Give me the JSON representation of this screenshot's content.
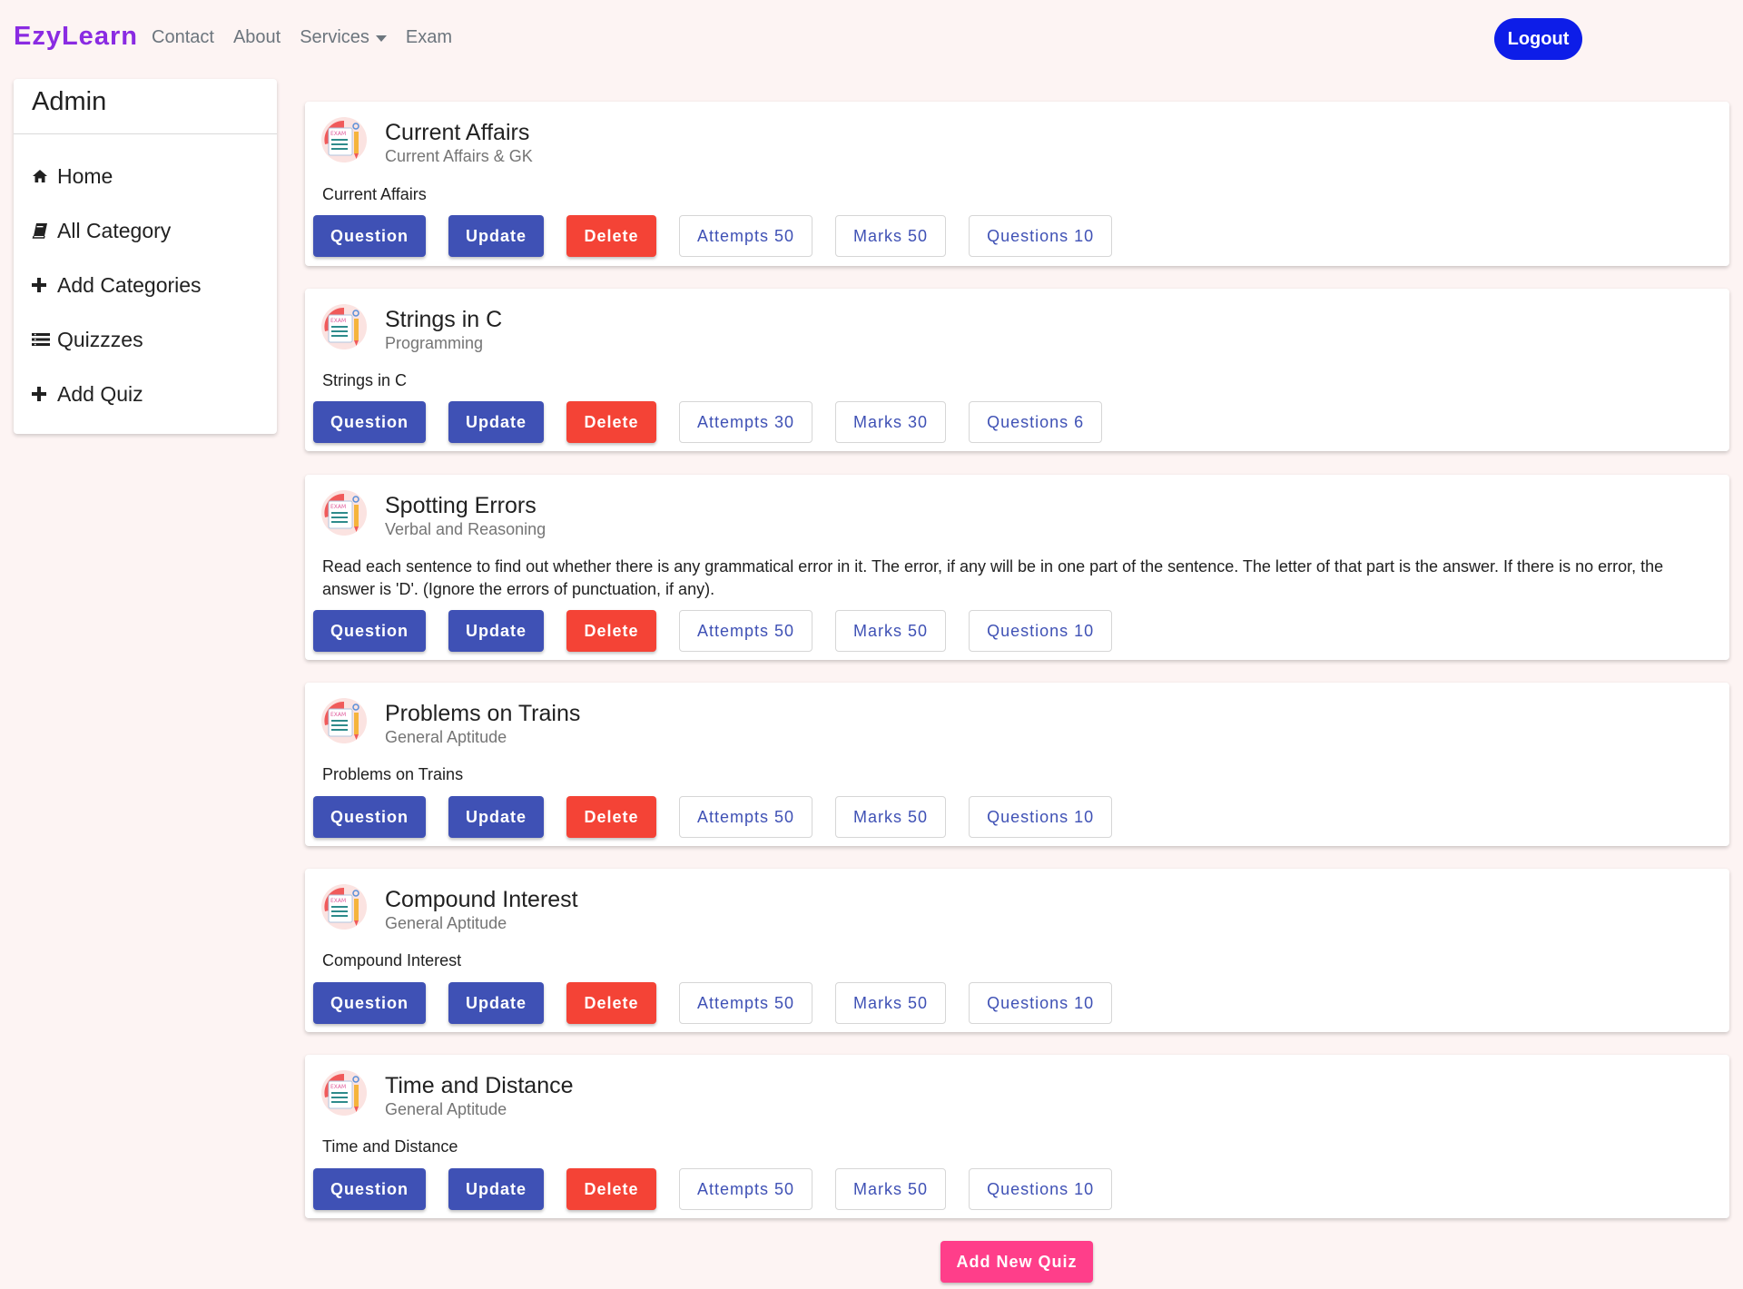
{
  "navbar": {
    "brand": "EzyLearn",
    "links": [
      "Contact",
      "About",
      "Services",
      "Exam"
    ],
    "logout_label": "Logout"
  },
  "sidebar": {
    "title": "Admin",
    "items": [
      {
        "label": "Home",
        "icon": "home-icon"
      },
      {
        "label": "All Category",
        "icon": "book-icon"
      },
      {
        "label": "Add Categories",
        "icon": "plus-icon"
      },
      {
        "label": "Quizzzes",
        "icon": "list-icon"
      },
      {
        "label": "Add Quiz",
        "icon": "plus-icon"
      }
    ]
  },
  "quiz_buttons": {
    "question": "Question",
    "update": "Update",
    "delete": "Delete"
  },
  "quizzes": [
    {
      "title": "Current Affairs",
      "category": "Current Affairs & GK",
      "description": "Current Affairs",
      "attempts": "Attempts 50",
      "marks": "Marks 50",
      "questions": "Questions 10"
    },
    {
      "title": "Strings in C",
      "category": "Programming",
      "description": "Strings in C",
      "attempts": "Attempts 30",
      "marks": "Marks 30",
      "questions": "Questions 6"
    },
    {
      "title": "Spotting Errors",
      "category": "Verbal and Reasoning",
      "description": "Read each sentence to find out whether there is any grammatical error in it. The error, if any will be in one part of the sentence. The letter of that part is the answer. If there is no error, the answer is 'D'. (Ignore the errors of punctuation, if any).",
      "attempts": "Attempts 50",
      "marks": "Marks 50",
      "questions": "Questions 10"
    },
    {
      "title": "Problems on Trains",
      "category": "General Aptitude",
      "description": "Problems on Trains",
      "attempts": "Attempts 50",
      "marks": "Marks 50",
      "questions": "Questions 10"
    },
    {
      "title": "Compound Interest",
      "category": "General Aptitude",
      "description": "Compound Interest",
      "attempts": "Attempts 50",
      "marks": "Marks 50",
      "questions": "Questions 10"
    },
    {
      "title": "Time and Distance",
      "category": "General Aptitude",
      "description": "Time and Distance",
      "attempts": "Attempts 50",
      "marks": "Marks 50",
      "questions": "Questions 10"
    }
  ],
  "add_quiz_label": "Add New Quiz",
  "colors": {
    "brand": "#8a2be2",
    "primary": "#3f51b5",
    "danger": "#f44336",
    "accent": "#ff3e8a",
    "logout": "#0d1de8"
  }
}
